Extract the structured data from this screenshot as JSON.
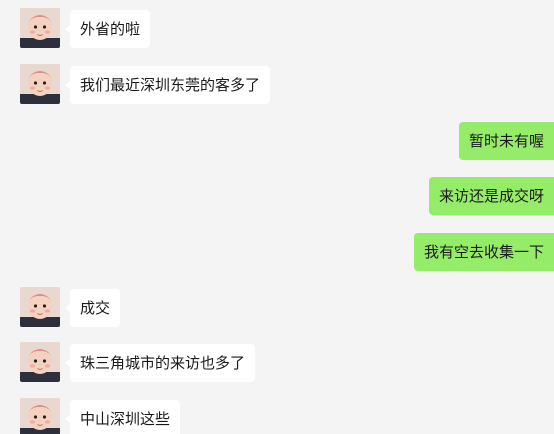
{
  "messages": [
    {
      "side": "in",
      "text": "外省的啦"
    },
    {
      "side": "in",
      "text": "我们最近深圳东莞的客多了"
    },
    {
      "side": "out",
      "text": "暂时未有喔"
    },
    {
      "side": "out",
      "text": "来访还是成交呀"
    },
    {
      "side": "out",
      "text": "我有空去收集一下"
    },
    {
      "side": "in",
      "text": "成交"
    },
    {
      "side": "in",
      "text": "珠三角城市的来访也多了"
    },
    {
      "side": "in",
      "text": "中山深圳这些"
    }
  ],
  "colors": {
    "background": "#f4f4f4",
    "incoming_bubble": "#ffffff",
    "outgoing_bubble": "#95ec69"
  },
  "icons": {
    "contact_avatar": "baby-portrait-avatar"
  }
}
